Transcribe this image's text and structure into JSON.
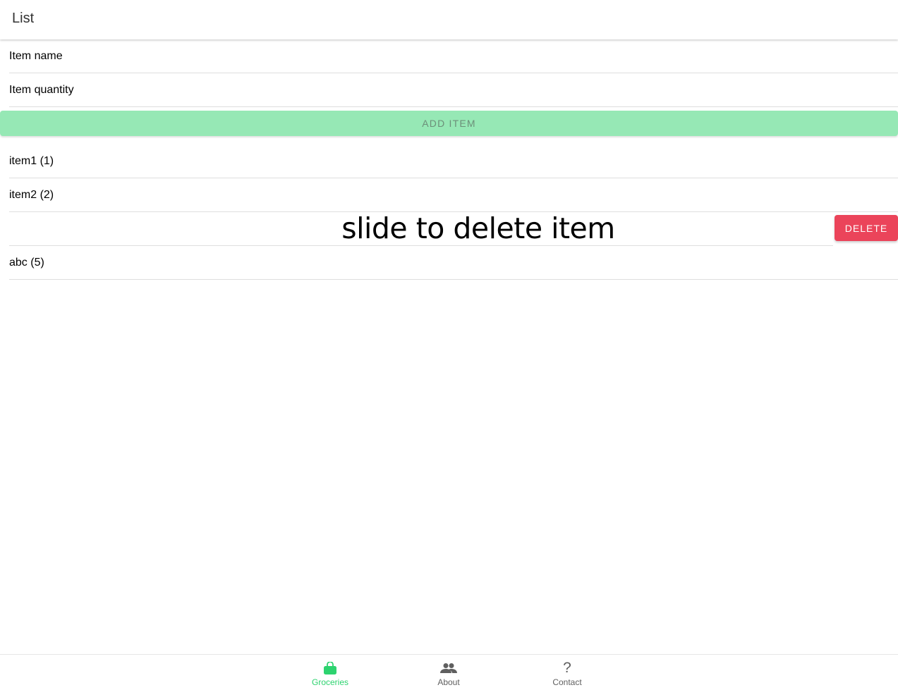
{
  "header": {
    "title": "List"
  },
  "form": {
    "name_placeholder": "Item name",
    "quantity_placeholder": "Item quantity",
    "add_button": "ADD ITEM"
  },
  "list": {
    "items": [
      {
        "label": "item1 (1)"
      },
      {
        "label": "item2 (2)"
      },
      {
        "label": "abc (5)"
      }
    ],
    "sliding_row": {
      "overlay_text": "slide to delete item",
      "delete_button": "DELETE"
    }
  },
  "tabs": [
    {
      "label": "Groceries",
      "icon": "shopping-bag-icon",
      "active": true
    },
    {
      "label": "About",
      "icon": "people-icon",
      "active": false
    },
    {
      "label": "Contact",
      "icon": "question-icon",
      "active": false
    }
  ],
  "colors": {
    "primary": "#2dd36f",
    "add_button_bg": "#96e8b5",
    "danger": "#eb445a"
  }
}
